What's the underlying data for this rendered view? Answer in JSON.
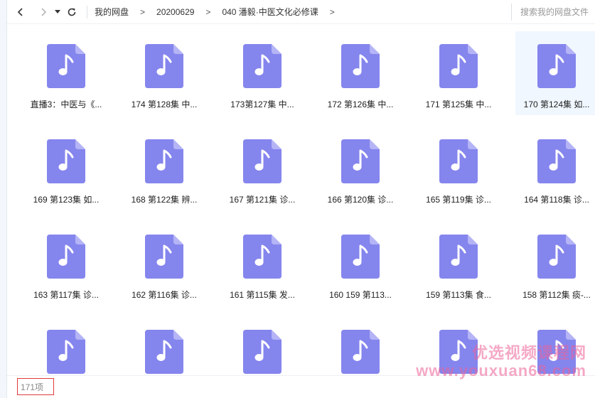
{
  "toolbar": {
    "breadcrumbs": [
      "我的网盘",
      "20200629",
      "040 潘毅·中医文化必修课"
    ],
    "separator": ">",
    "search_placeholder": "搜索我的网盘文件"
  },
  "files": [
    {
      "label": "直播3：中医与《..."
    },
    {
      "label": "174 第128集 中..."
    },
    {
      "label": "173第127集 中..."
    },
    {
      "label": "172 第126集 中..."
    },
    {
      "label": "171 第125集 中..."
    },
    {
      "label": "170 第124集 如..."
    },
    {
      "label": "169 第123集 如..."
    },
    {
      "label": "168 第122集 辨..."
    },
    {
      "label": "167 第121集 诊..."
    },
    {
      "label": "166 第120集 诊..."
    },
    {
      "label": "165 第119集 诊..."
    },
    {
      "label": "164 第118集 诊..."
    },
    {
      "label": "163 第117集 诊..."
    },
    {
      "label": "162 第116集 诊..."
    },
    {
      "label": "161 第115集 发..."
    },
    {
      "label": "160 159 第113..."
    },
    {
      "label": "159 第113集 食..."
    },
    {
      "label": "158 第112集 痰-..."
    },
    {
      "label": ""
    },
    {
      "label": ""
    },
    {
      "label": ""
    },
    {
      "label": ""
    },
    {
      "label": ""
    },
    {
      "label": ""
    }
  ],
  "selected_index": 5,
  "status": {
    "count": "171项"
  },
  "watermark": {
    "line1": "优选视频课程网",
    "line2": "www.youxuan68.com"
  },
  "icon": {
    "name": "audio-file-icon",
    "color": "#8585ee",
    "fold_color": "#b4b4f6"
  }
}
